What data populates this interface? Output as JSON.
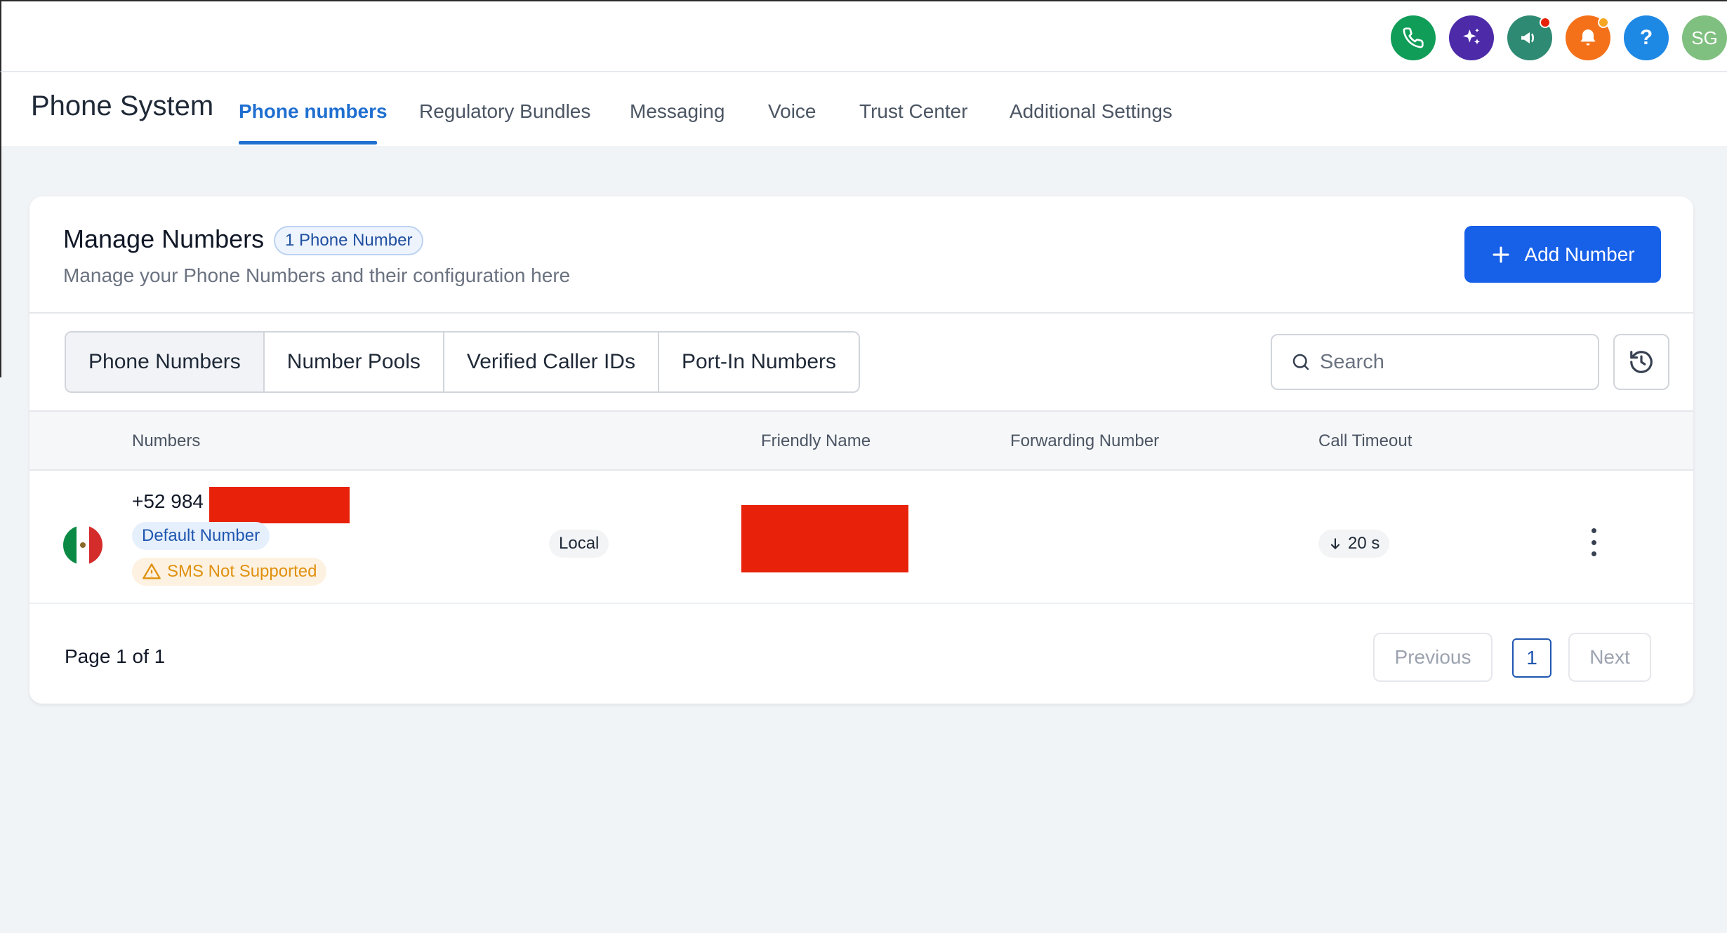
{
  "topbar": {
    "icons": [
      {
        "name": "phone-icon",
        "color": "#0f9d58"
      },
      {
        "name": "sparkle-icon",
        "color": "#4c2aa8"
      },
      {
        "name": "megaphone-icon",
        "color": "#2f8a73",
        "dot": "#e8220a"
      },
      {
        "name": "bell-icon",
        "color": "#f4711a",
        "dot": "#f6a623"
      },
      {
        "name": "help-icon",
        "color": "#1e88e5"
      }
    ],
    "help_label": "?",
    "avatar_initials": "SG"
  },
  "header": {
    "title": "Phone System",
    "tabs": [
      {
        "label": "Phone numbers",
        "active": true
      },
      {
        "label": "Regulatory Bundles"
      },
      {
        "label": "Messaging"
      },
      {
        "label": "Voice"
      },
      {
        "label": "Trust Center"
      },
      {
        "label": "Additional Settings"
      }
    ]
  },
  "card": {
    "title": "Manage Numbers",
    "count_badge": "1 Phone Number",
    "subtitle": "Manage your Phone Numbers and their configuration here",
    "add_button": "Add Number",
    "segments": [
      {
        "label": "Phone Numbers",
        "active": true
      },
      {
        "label": "Number Pools"
      },
      {
        "label": "Verified Caller IDs"
      },
      {
        "label": "Port-In Numbers"
      }
    ],
    "search": {
      "placeholder": "Search",
      "value": ""
    },
    "columns": {
      "numbers": "Numbers",
      "friendly_name": "Friendly Name",
      "forwarding_number": "Forwarding Number",
      "call_timeout": "Call Timeout"
    },
    "rows": [
      {
        "country_flag": "mexico-flag-icon",
        "number": "+52 984",
        "default_badge": "Default Number",
        "warning_badge": "SMS Not Supported",
        "type": "Local",
        "forwarding_number": "",
        "call_timeout": "20 s"
      }
    ],
    "pagination": {
      "page_info": "Page 1 of 1",
      "previous": "Previous",
      "current": "1",
      "next": "Next"
    }
  }
}
